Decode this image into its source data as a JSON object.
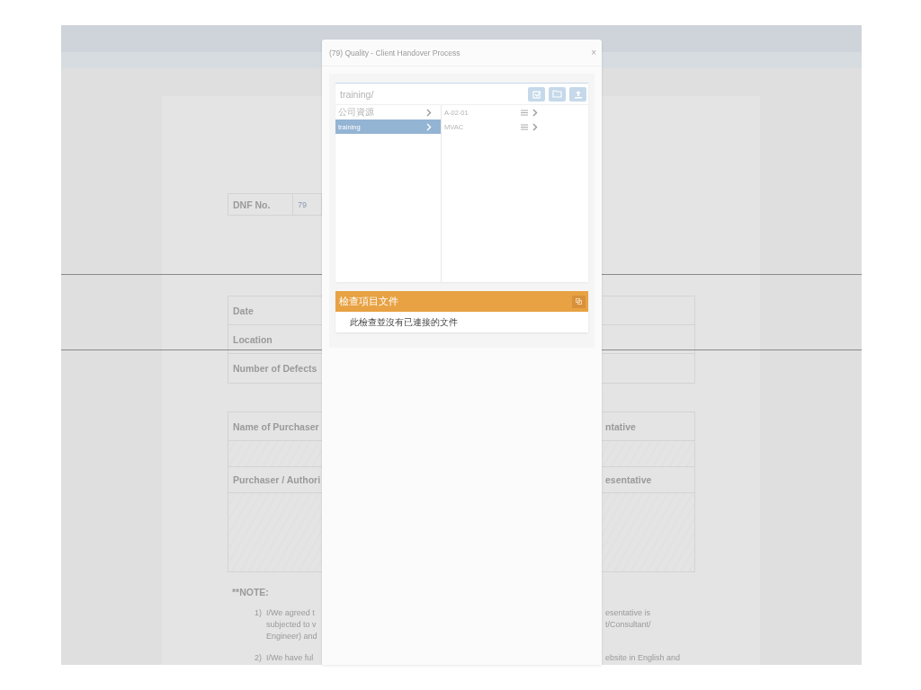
{
  "document": {
    "dnf": {
      "label": "DNF No.",
      "value": "79"
    },
    "details": [
      {
        "label": "Date"
      },
      {
        "label": "Location"
      },
      {
        "label": "Number of Defects"
      }
    ],
    "signatures": [
      {
        "kind": "label",
        "left": "Name of Purchaser",
        "right": "ntative"
      },
      {
        "kind": "blank"
      },
      {
        "kind": "label",
        "left": "Purchaser / Authori",
        "right": "esentative"
      },
      {
        "kind": "signature"
      }
    ],
    "note": {
      "title": "**NOTE:",
      "items": [
        {
          "number": "1)",
          "left_lines": [
            "I/We agreed t",
            "subjected to v",
            "Engineer) and"
          ],
          "right_lines": [
            "esentative is",
            "t/Consultant/"
          ]
        },
        {
          "number": "2)",
          "left_lines": [
            "I/We have ful"
          ],
          "right_lines": [
            "ebsite in English and"
          ]
        }
      ]
    }
  },
  "dialog": {
    "title": "(79) Quality - Client Handover Process",
    "close": "×",
    "path": "training/",
    "folders": [
      {
        "name": "公司資源",
        "selected": false
      },
      {
        "name": "training",
        "selected": true
      }
    ],
    "files": [
      {
        "name": "A-02-01"
      },
      {
        "name": "MVAC"
      }
    ],
    "documents": {
      "title": "檢查項目文件",
      "empty_message": "此檢查並沒有已連接的文件"
    }
  }
}
